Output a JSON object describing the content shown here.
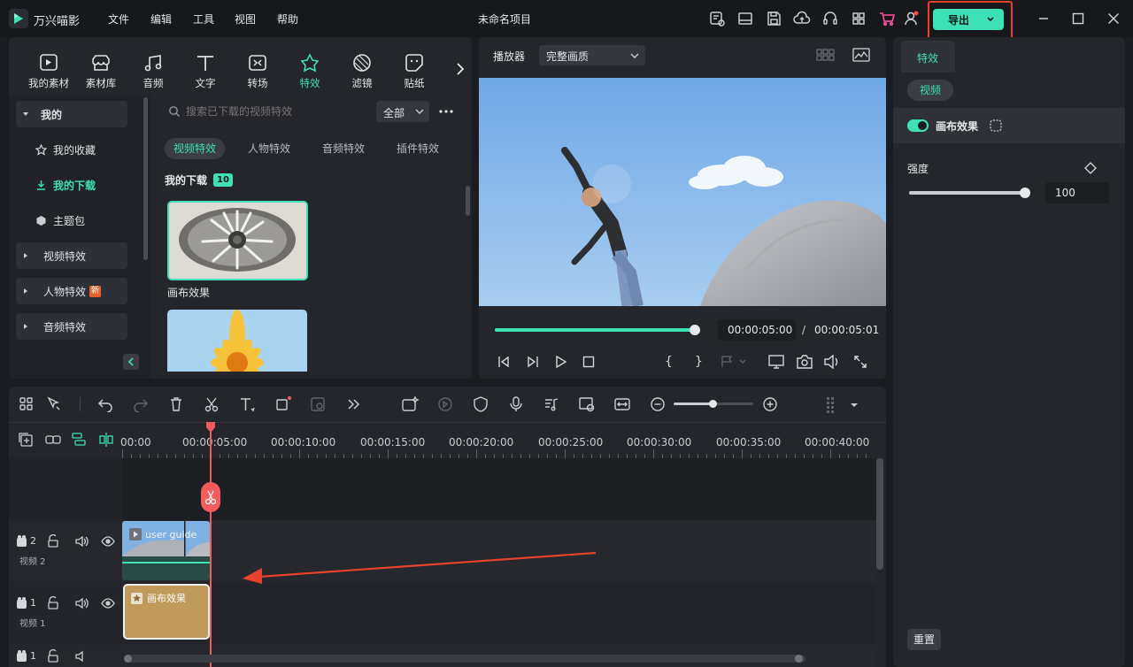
{
  "app": {
    "name": "万兴喵影",
    "project_title": "未命名项目"
  },
  "menu": [
    "文件",
    "编辑",
    "工具",
    "视图",
    "帮助"
  ],
  "export_button": {
    "label": "导出"
  },
  "categories": [
    {
      "label": "我的素材",
      "icon": "media-icon"
    },
    {
      "label": "素材库",
      "icon": "library-icon"
    },
    {
      "label": "音频",
      "icon": "music-icon"
    },
    {
      "label": "文字",
      "icon": "text-icon"
    },
    {
      "label": "转场",
      "icon": "transition-icon"
    },
    {
      "label": "特效",
      "icon": "effects-icon",
      "active": true
    },
    {
      "label": "滤镜",
      "icon": "filter-icon"
    },
    {
      "label": "贴纸",
      "icon": "sticker-icon"
    }
  ],
  "sidebar": {
    "items": [
      {
        "label": "我的"
      },
      {
        "label": "我的收藏"
      },
      {
        "label": "我的下载"
      },
      {
        "label": "主题包"
      },
      {
        "label": "视频特效"
      },
      {
        "label": "人物特效",
        "badge": "新"
      },
      {
        "label": "音频特效"
      }
    ]
  },
  "browser": {
    "search_placeholder": "搜索已下载的视频特效",
    "filter": "全部",
    "tabs": [
      "视频特效",
      "人物特效",
      "音频特效",
      "插件特效"
    ],
    "section_title": "我的下载",
    "section_count": "10",
    "items": [
      {
        "label": "画布效果"
      }
    ]
  },
  "player": {
    "label": "播放器",
    "quality": "完整画质",
    "current_time": "00:00:05:00",
    "separator": "/",
    "total_time": "00:00:05:01",
    "progress": 1.0
  },
  "inspector": {
    "tab": "特效",
    "subtab": "视频",
    "effect_name": "画布效果",
    "strength_label": "强度",
    "strength_value": "100",
    "strength_fraction": 1.0,
    "reset_label": "重置"
  },
  "timeline": {
    "ruler": [
      "00:00",
      "00:00:05:00",
      "00:00:10:00",
      "00:00:15:00",
      "00:00:20:00",
      "00:00:25:00",
      "00:00:30:00",
      "00:00:35:00",
      "00:00:40:00"
    ],
    "tracks": [
      {
        "index": "2",
        "name": "视频 2",
        "clip": "user guide"
      },
      {
        "index": "1",
        "name": "视频 1",
        "clip": "画布效果"
      },
      {
        "index": "1"
      }
    ]
  },
  "colors": {
    "accent": "#3ee0b5",
    "playhead": "#f45b5b",
    "annotation": "#e8412f",
    "effect_clip": "#c19a5b"
  }
}
